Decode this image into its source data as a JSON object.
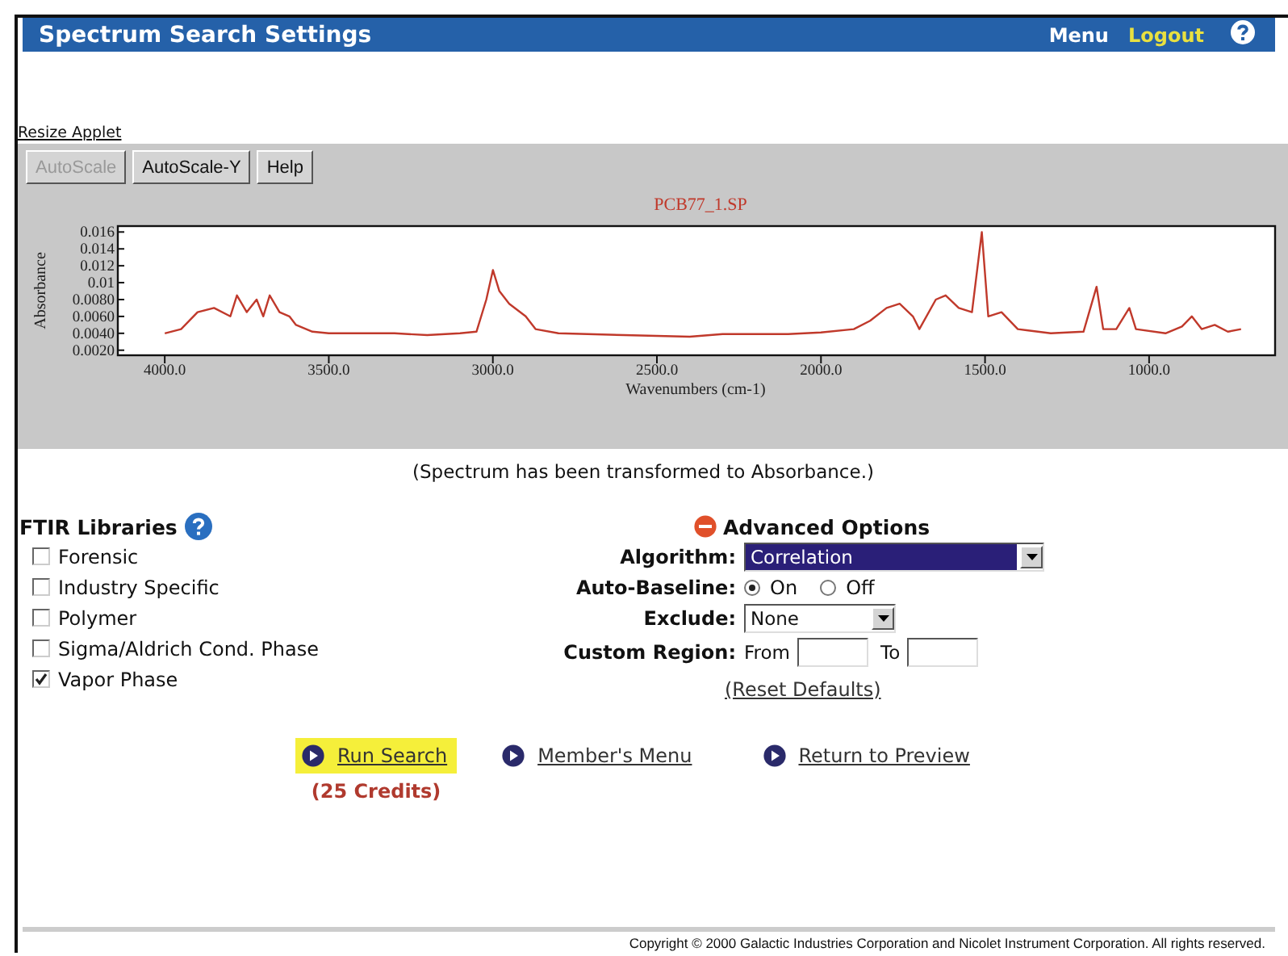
{
  "header": {
    "title": "Spectrum Search Settings",
    "menu_link": "Menu",
    "logout_link": "Logout"
  },
  "applet": {
    "resize_link": "Resize Applet",
    "buttons": [
      {
        "label": "AutoScale",
        "disabled": true
      },
      {
        "label": "AutoScale-Y",
        "disabled": false
      },
      {
        "label": "Help",
        "disabled": false
      }
    ],
    "chart_data": {
      "type": "line",
      "title": "PCB77_1.SP",
      "xlabel": "Wavenumbers (cm-1)",
      "ylabel": "Absorbance",
      "xlim": [
        4143,
        616
      ],
      "ylim": [
        0.0014,
        0.0167
      ],
      "xticks": [
        {
          "value": 4000,
          "label": "4000.0"
        },
        {
          "value": 3500,
          "label": "3500.0"
        },
        {
          "value": 3000,
          "label": "3000.0"
        },
        {
          "value": 2500,
          "label": "2500.0"
        },
        {
          "value": 2000,
          "label": "2000.0"
        },
        {
          "value": 1500,
          "label": "1500.0"
        },
        {
          "value": 1000,
          "label": "1000.0"
        }
      ],
      "yticks": [
        {
          "value": 0.016,
          "label": "0.016"
        },
        {
          "value": 0.014,
          "label": "0.014"
        },
        {
          "value": 0.012,
          "label": "0.012"
        },
        {
          "value": 0.01,
          "label": "0.01"
        },
        {
          "value": 0.008,
          "label": "0.0080"
        },
        {
          "value": 0.006,
          "label": "0.0060"
        },
        {
          "value": 0.004,
          "label": "0.0040"
        },
        {
          "value": 0.002,
          "label": "0.0020"
        }
      ],
      "x": [
        4000,
        3950,
        3900,
        3850,
        3800,
        3780,
        3750,
        3720,
        3700,
        3680,
        3650,
        3620,
        3600,
        3550,
        3500,
        3300,
        3200,
        3100,
        3050,
        3020,
        3000,
        2980,
        2950,
        2900,
        2870,
        2800,
        2600,
        2400,
        2300,
        2100,
        2000,
        1900,
        1850,
        1800,
        1760,
        1720,
        1700,
        1650,
        1620,
        1580,
        1540,
        1510,
        1490,
        1450,
        1400,
        1300,
        1200,
        1160,
        1140,
        1100,
        1060,
        1040,
        950,
        900,
        870,
        840,
        800,
        760,
        720
      ],
      "series": [
        {
          "color": "#c0392b",
          "values": [
            0.004,
            0.0045,
            0.0065,
            0.007,
            0.006,
            0.0085,
            0.0065,
            0.008,
            0.006,
            0.0085,
            0.0065,
            0.006,
            0.005,
            0.0042,
            0.004,
            0.004,
            0.0038,
            0.004,
            0.0042,
            0.008,
            0.0115,
            0.009,
            0.0075,
            0.006,
            0.0045,
            0.004,
            0.0038,
            0.0036,
            0.0039,
            0.0039,
            0.0041,
            0.0045,
            0.0055,
            0.007,
            0.0075,
            0.006,
            0.0045,
            0.008,
            0.0085,
            0.007,
            0.0065,
            0.016,
            0.006,
            0.0065,
            0.0045,
            0.004,
            0.0042,
            0.0095,
            0.0045,
            0.0045,
            0.007,
            0.0045,
            0.004,
            0.0048,
            0.006,
            0.0045,
            0.005,
            0.0042,
            0.0045
          ]
        }
      ]
    }
  },
  "note": "(Spectrum has been transformed to Absorbance.)",
  "libraries": {
    "title": "FTIR Libraries",
    "items": [
      {
        "label": "Forensic",
        "checked": false
      },
      {
        "label": "Industry Specific",
        "checked": false
      },
      {
        "label": "Polymer",
        "checked": false
      },
      {
        "label": "Sigma/Aldrich Cond. Phase",
        "checked": false
      },
      {
        "label": "Vapor Phase",
        "checked": true
      }
    ]
  },
  "advanced": {
    "title": "Advanced Options",
    "expanded": true,
    "algorithm": {
      "label": "Algorithm:",
      "value": "Correlation"
    },
    "auto_baseline": {
      "label": "Auto-Baseline:",
      "options": [
        {
          "label": "On",
          "selected": true
        },
        {
          "label": "Off",
          "selected": false
        }
      ]
    },
    "exclude": {
      "label": "Exclude:",
      "value": "None"
    },
    "custom_region": {
      "label": "Custom Region:",
      "from_label": "From",
      "to_label": "To"
    },
    "reset_link": "(Reset Defaults)"
  },
  "actions": [
    {
      "label": "Run Search",
      "highlighted": true
    },
    {
      "label": "Member's Menu",
      "highlighted": false
    },
    {
      "label": "Return to Preview",
      "highlighted": false
    }
  ],
  "credits": "(25 Credits)",
  "copyright": "Copyright © 2000 Galactic Industries Corporation and Nicolet Instrument Corporation. All rights reserved."
}
